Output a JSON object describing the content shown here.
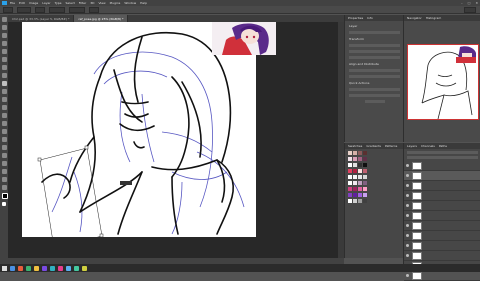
{
  "menubar": {
    "items": [
      "File",
      "Edit",
      "Image",
      "Layer",
      "Type",
      "Select",
      "Filter",
      "3D",
      "View",
      "Plugins",
      "Window",
      "Help"
    ]
  },
  "tabs": [
    {
      "label": "Ch2.psd @ 33.3% (Layer 5, RGB/8#) *"
    },
    {
      "label": "ref_pose.jpg @ 25% (RGB/8) *"
    }
  ],
  "panels": {
    "properties_tabs": [
      "Properties",
      "Info"
    ],
    "properties_sections": [
      "Layer",
      "Transform",
      "Align and Distribute",
      "Quick Actions"
    ],
    "navigator_tabs": [
      "Navigator",
      "Histogram"
    ],
    "swatches_tabs": [
      "Swatches",
      "Gradients",
      "Patterns"
    ],
    "layers_tabs": [
      "Layers",
      "Channels",
      "Paths"
    ]
  },
  "swatch_groups": [
    {
      "label": "",
      "colors": [
        "#e8d0c8",
        "#d4b0a8",
        "#8a5a5a",
        "#5a3030"
      ]
    },
    {
      "label": "",
      "colors": [
        "#f0e0e8",
        "#d8a0b8",
        "#a06080",
        "#603048"
      ]
    },
    {
      "label": "",
      "colors": [
        "#ffffff",
        "#e0e0e0",
        "#303030",
        "#101010"
      ]
    },
    {
      "label": "",
      "colors": [
        "#e04060",
        "#b02040",
        "#ffe0e0",
        "#c06070"
      ]
    },
    {
      "label": "",
      "colors": [
        "#ffffff",
        "#f8f8f8",
        "#e8e8e8",
        "#d8d8d8"
      ]
    },
    {
      "label": "",
      "colors": [
        "#ffffff",
        "#f0e8f0",
        "#c0a0c0",
        "#806080"
      ]
    },
    {
      "label": "",
      "colors": [
        "#d04080",
        "#a02060",
        "#e060a0",
        "#ffa0c8"
      ]
    },
    {
      "label": "",
      "colors": [
        "#8040c0",
        "#6020a0",
        "#a060e0",
        "#c8a0f0"
      ]
    },
    {
      "label": "",
      "colors": [
        "#ffffff",
        "#d0d0d0",
        "#a0a0a0",
        "#404040"
      ]
    }
  ],
  "layers": [
    {
      "name": "",
      "selected": false
    },
    {
      "name": "",
      "selected": true
    },
    {
      "name": "",
      "selected": false
    },
    {
      "name": "",
      "selected": false
    },
    {
      "name": "",
      "selected": false
    },
    {
      "name": "",
      "selected": false
    },
    {
      "name": "",
      "selected": false
    },
    {
      "name": "",
      "selected": false
    },
    {
      "name": "",
      "selected": false
    },
    {
      "name": "",
      "selected": false
    },
    {
      "name": "",
      "selected": false
    },
    {
      "name": "",
      "selected": false
    }
  ],
  "colors": {
    "accent": "#2aa0e8",
    "taskbar_icons": [
      "#4a90e2",
      "#e85d3c",
      "#3cb371",
      "#f0c040",
      "#7a4ae2",
      "#30b0c0",
      "#e83c8c",
      "#5ab0f0",
      "#44c8a0",
      "#d0d040"
    ]
  }
}
